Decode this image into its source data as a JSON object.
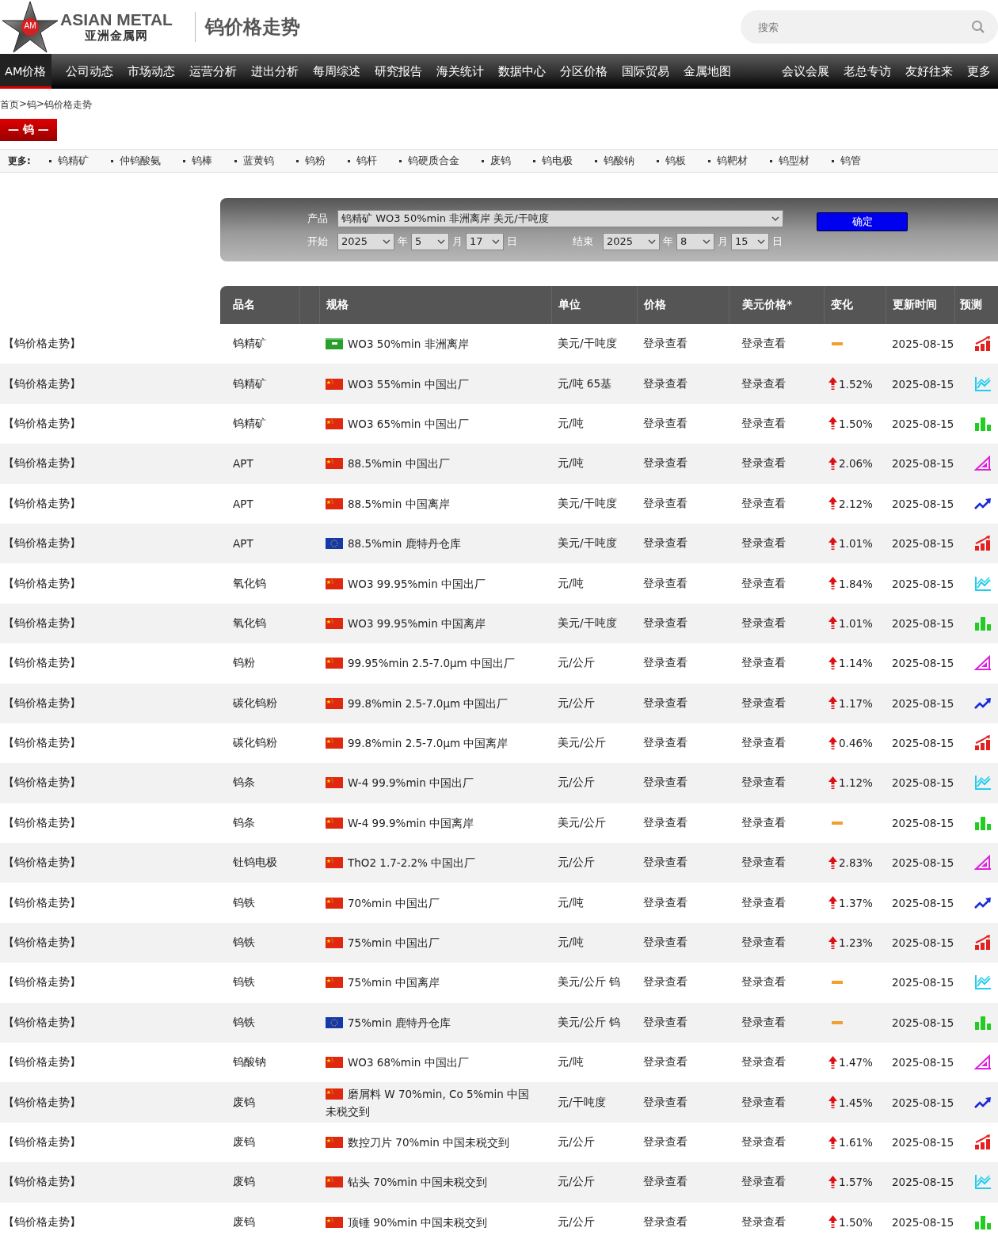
{
  "header": {
    "logo": {
      "badge": "AM",
      "latin": "ASIAN METAL",
      "chinese": "亚洲金属网"
    },
    "page_title": "钨价格走势",
    "search": {
      "placeholder": "搜索"
    }
  },
  "nav": {
    "left": [
      {
        "label": "AM价格",
        "selected": true
      },
      {
        "label": "公司动态",
        "selected": false
      },
      {
        "label": "市场动态",
        "selected": false
      },
      {
        "label": "运营分析",
        "selected": false
      },
      {
        "label": "进出分析",
        "selected": false
      },
      {
        "label": "每周综述",
        "selected": false
      },
      {
        "label": "研究报告",
        "selected": false
      },
      {
        "label": "海关统计",
        "selected": false
      },
      {
        "label": "数据中心",
        "selected": false
      },
      {
        "label": "分区价格",
        "selected": false
      },
      {
        "label": "国际贸易",
        "selected": false
      },
      {
        "label": "金属地图",
        "selected": false
      }
    ],
    "right": [
      {
        "label": "会议会展",
        "selected": false
      },
      {
        "label": "老总专访",
        "selected": false
      },
      {
        "label": "友好往来",
        "selected": false
      },
      {
        "label": "更多",
        "selected": false
      }
    ]
  },
  "breadcrumb": {
    "items": [
      "首页",
      "钨",
      "钨价格走势"
    ],
    "separator": ">"
  },
  "metal_tag": "— 钨 —",
  "more": {
    "label": "更多:",
    "items": [
      "钨精矿",
      "仲钨酸氨",
      "钨棒",
      "蓝黄钨",
      "钨粉",
      "钨杆",
      "钨硬质合金",
      "废钨",
      "钨电极",
      "钨酸钠",
      "钨板",
      "钨靶材",
      "钨型材",
      "钨管"
    ]
  },
  "filter": {
    "product": {
      "label": "产品",
      "value": "钨精矿 WO3 50%min 非洲离岸 美元/干吨度"
    },
    "start": {
      "label": "开始",
      "year": "2025",
      "year_unit": "年",
      "month": "5",
      "month_unit": "月",
      "day": "17",
      "day_unit": "日"
    },
    "end": {
      "label": "结束",
      "year": "2025",
      "year_unit": "年",
      "month": "8",
      "month_unit": "月",
      "day": "15",
      "day_unit": "日"
    },
    "submit": "确定"
  },
  "table": {
    "columns": [
      "品名",
      "规格",
      "单位",
      "价格",
      "美元价格*",
      "变化",
      "更新时间",
      "预测"
    ],
    "rows": [
      {
        "category": "【钨价格走势】",
        "name": "钨精矿",
        "flag": {
          "kind": "africa"
        },
        "spec": "WO3 50%min 非洲离岸",
        "unit": "美元/干吨度",
        "price": "登录查看",
        "usd_price": "登录查看",
        "change": {
          "kind": "flat"
        },
        "updated": "2025-08-15",
        "forecast": {
          "kind": "bars-red"
        }
      },
      {
        "category": "【钨价格走势】",
        "name": "钨精矿",
        "flag": {
          "kind": "china"
        },
        "spec": "WO3 55%min 中国出厂",
        "unit": "元/吨 65基",
        "price": "登录查看",
        "usd_price": "登录查看",
        "change": {
          "kind": "up",
          "value": "1.52%"
        },
        "updated": "2025-08-15",
        "forecast": {
          "kind": "line-cyan"
        }
      },
      {
        "category": "【钨价格走势】",
        "name": "钨精矿",
        "flag": {
          "kind": "china"
        },
        "spec": "WO3 65%min 中国出厂",
        "unit": "元/吨",
        "price": "登录查看",
        "usd_price": "登录查看",
        "change": {
          "kind": "up",
          "value": "1.50%"
        },
        "updated": "2025-08-15",
        "forecast": {
          "kind": "bars-green"
        }
      },
      {
        "category": "【钨价格走势】",
        "name": "APT",
        "flag": {
          "kind": "china"
        },
        "spec": "88.5%min 中国出厂",
        "unit": "元/吨",
        "price": "登录查看",
        "usd_price": "登录查看",
        "change": {
          "kind": "up",
          "value": "2.06%"
        },
        "updated": "2025-08-15",
        "forecast": {
          "kind": "ruler-magenta"
        }
      },
      {
        "category": "【钨价格走势】",
        "name": "APT",
        "flag": {
          "kind": "china"
        },
        "spec": "88.5%min 中国离岸",
        "unit": "美元/干吨度",
        "price": "登录查看",
        "usd_price": "登录查看",
        "change": {
          "kind": "up",
          "value": "2.12%"
        },
        "updated": "2025-08-15",
        "forecast": {
          "kind": "trend-blue"
        }
      },
      {
        "category": "【钨价格走势】",
        "name": "APT",
        "flag": {
          "kind": "eu"
        },
        "spec": "88.5%min 鹿特丹仓库",
        "unit": "美元/干吨度",
        "price": "登录查看",
        "usd_price": "登录查看",
        "change": {
          "kind": "up",
          "value": "1.01%"
        },
        "updated": "2025-08-15",
        "forecast": {
          "kind": "bars-red"
        }
      },
      {
        "category": "【钨价格走势】",
        "name": "氧化钨",
        "flag": {
          "kind": "china"
        },
        "spec": "WO3 99.95%min 中国出厂",
        "unit": "元/吨",
        "price": "登录查看",
        "usd_price": "登录查看",
        "change": {
          "kind": "up",
          "value": "1.84%"
        },
        "updated": "2025-08-15",
        "forecast": {
          "kind": "line-cyan"
        }
      },
      {
        "category": "【钨价格走势】",
        "name": "氧化钨",
        "flag": {
          "kind": "china"
        },
        "spec": "WO3 99.95%min 中国离岸",
        "unit": "美元/干吨度",
        "price": "登录查看",
        "usd_price": "登录查看",
        "change": {
          "kind": "up",
          "value": "1.01%"
        },
        "updated": "2025-08-15",
        "forecast": {
          "kind": "bars-green"
        }
      },
      {
        "category": "【钨价格走势】",
        "name": "钨粉",
        "flag": {
          "kind": "china"
        },
        "spec": "99.95%min 2.5-7.0µm 中国出厂",
        "unit": "元/公斤",
        "price": "登录查看",
        "usd_price": "登录查看",
        "change": {
          "kind": "up",
          "value": "1.14%"
        },
        "updated": "2025-08-15",
        "forecast": {
          "kind": "ruler-magenta"
        }
      },
      {
        "category": "【钨价格走势】",
        "name": "碳化钨粉",
        "flag": {
          "kind": "china"
        },
        "spec": "99.8%min 2.5-7.0µm 中国出厂",
        "unit": "元/公斤",
        "price": "登录查看",
        "usd_price": "登录查看",
        "change": {
          "kind": "up",
          "value": "1.17%"
        },
        "updated": "2025-08-15",
        "forecast": {
          "kind": "trend-blue"
        }
      },
      {
        "category": "【钨价格走势】",
        "name": "碳化钨粉",
        "flag": {
          "kind": "china"
        },
        "spec": "99.8%min 2.5-7.0µm 中国离岸",
        "unit": "美元/公斤",
        "price": "登录查看",
        "usd_price": "登录查看",
        "change": {
          "kind": "up",
          "value": "0.46%"
        },
        "updated": "2025-08-15",
        "forecast": {
          "kind": "bars-red"
        }
      },
      {
        "category": "【钨价格走势】",
        "name": "钨条",
        "flag": {
          "kind": "china"
        },
        "spec": "W-4 99.9%min 中国出厂",
        "unit": "元/公斤",
        "price": "登录查看",
        "usd_price": "登录查看",
        "change": {
          "kind": "up",
          "value": "1.12%"
        },
        "updated": "2025-08-15",
        "forecast": {
          "kind": "line-cyan"
        }
      },
      {
        "category": "【钨价格走势】",
        "name": "钨条",
        "flag": {
          "kind": "china"
        },
        "spec": "W-4 99.9%min 中国离岸",
        "unit": "美元/公斤",
        "price": "登录查看",
        "usd_price": "登录查看",
        "change": {
          "kind": "flat"
        },
        "updated": "2025-08-15",
        "forecast": {
          "kind": "bars-green"
        }
      },
      {
        "category": "【钨价格走势】",
        "name": "钍钨电极",
        "flag": {
          "kind": "china"
        },
        "spec": "ThO2 1.7-2.2% 中国出厂",
        "unit": "元/公斤",
        "price": "登录查看",
        "usd_price": "登录查看",
        "change": {
          "kind": "up",
          "value": "2.83%"
        },
        "updated": "2025-08-15",
        "forecast": {
          "kind": "ruler-magenta"
        }
      },
      {
        "category": "【钨价格走势】",
        "name": "钨铁",
        "flag": {
          "kind": "china"
        },
        "spec": "70%min 中国出厂",
        "unit": "元/吨",
        "price": "登录查看",
        "usd_price": "登录查看",
        "change": {
          "kind": "up",
          "value": "1.37%"
        },
        "updated": "2025-08-15",
        "forecast": {
          "kind": "trend-blue"
        }
      },
      {
        "category": "【钨价格走势】",
        "name": "钨铁",
        "flag": {
          "kind": "china"
        },
        "spec": "75%min 中国出厂",
        "unit": "元/吨",
        "price": "登录查看",
        "usd_price": "登录查看",
        "change": {
          "kind": "up",
          "value": "1.23%"
        },
        "updated": "2025-08-15",
        "forecast": {
          "kind": "bars-red"
        }
      },
      {
        "category": "【钨价格走势】",
        "name": "钨铁",
        "flag": {
          "kind": "china"
        },
        "spec": "75%min 中国离岸",
        "unit": "美元/公斤 钨",
        "price": "登录查看",
        "usd_price": "登录查看",
        "change": {
          "kind": "flat"
        },
        "updated": "2025-08-15",
        "forecast": {
          "kind": "line-cyan"
        }
      },
      {
        "category": "【钨价格走势】",
        "name": "钨铁",
        "flag": {
          "kind": "eu"
        },
        "spec": "75%min 鹿特丹仓库",
        "unit": "美元/公斤 钨",
        "price": "登录查看",
        "usd_price": "登录查看",
        "change": {
          "kind": "flat"
        },
        "updated": "2025-08-15",
        "forecast": {
          "kind": "bars-green"
        }
      },
      {
        "category": "【钨价格走势】",
        "name": "钨酸钠",
        "flag": {
          "kind": "china"
        },
        "spec": "WO3 68%min 中国出厂",
        "unit": "元/吨",
        "price": "登录查看",
        "usd_price": "登录查看",
        "change": {
          "kind": "up",
          "value": "1.47%"
        },
        "updated": "2025-08-15",
        "forecast": {
          "kind": "ruler-magenta"
        }
      },
      {
        "category": "【钨价格走势】",
        "name": "废钨",
        "flag": {
          "kind": "china"
        },
        "spec": "磨屑料 W 70%min, Co 5%min 中国未税交到",
        "unit": "元/干吨度",
        "price": "登录查看",
        "usd_price": "登录查看",
        "change": {
          "kind": "up",
          "value": "1.45%"
        },
        "updated": "2025-08-15",
        "forecast": {
          "kind": "trend-blue"
        }
      },
      {
        "category": "【钨价格走势】",
        "name": "废钨",
        "flag": {
          "kind": "china"
        },
        "spec": "数控刀片 70%min 中国未税交到",
        "unit": "元/公斤",
        "price": "登录查看",
        "usd_price": "登录查看",
        "change": {
          "kind": "up",
          "value": "1.61%"
        },
        "updated": "2025-08-15",
        "forecast": {
          "kind": "bars-red"
        }
      },
      {
        "category": "【钨价格走势】",
        "name": "废钨",
        "flag": {
          "kind": "china"
        },
        "spec": "钻头 70%min 中国未税交到",
        "unit": "元/公斤",
        "price": "登录查看",
        "usd_price": "登录查看",
        "change": {
          "kind": "up",
          "value": "1.57%"
        },
        "updated": "2025-08-15",
        "forecast": {
          "kind": "line-cyan"
        }
      },
      {
        "category": "【钨价格走势】",
        "name": "废钨",
        "flag": {
          "kind": "china"
        },
        "spec": "顶锤 90%min 中国未税交到",
        "unit": "元/公斤",
        "price": "登录查看",
        "usd_price": "登录查看",
        "change": {
          "kind": "up",
          "value": "1.50%"
        },
        "updated": "2025-08-15",
        "forecast": {
          "kind": "bars-green"
        }
      }
    ]
  }
}
